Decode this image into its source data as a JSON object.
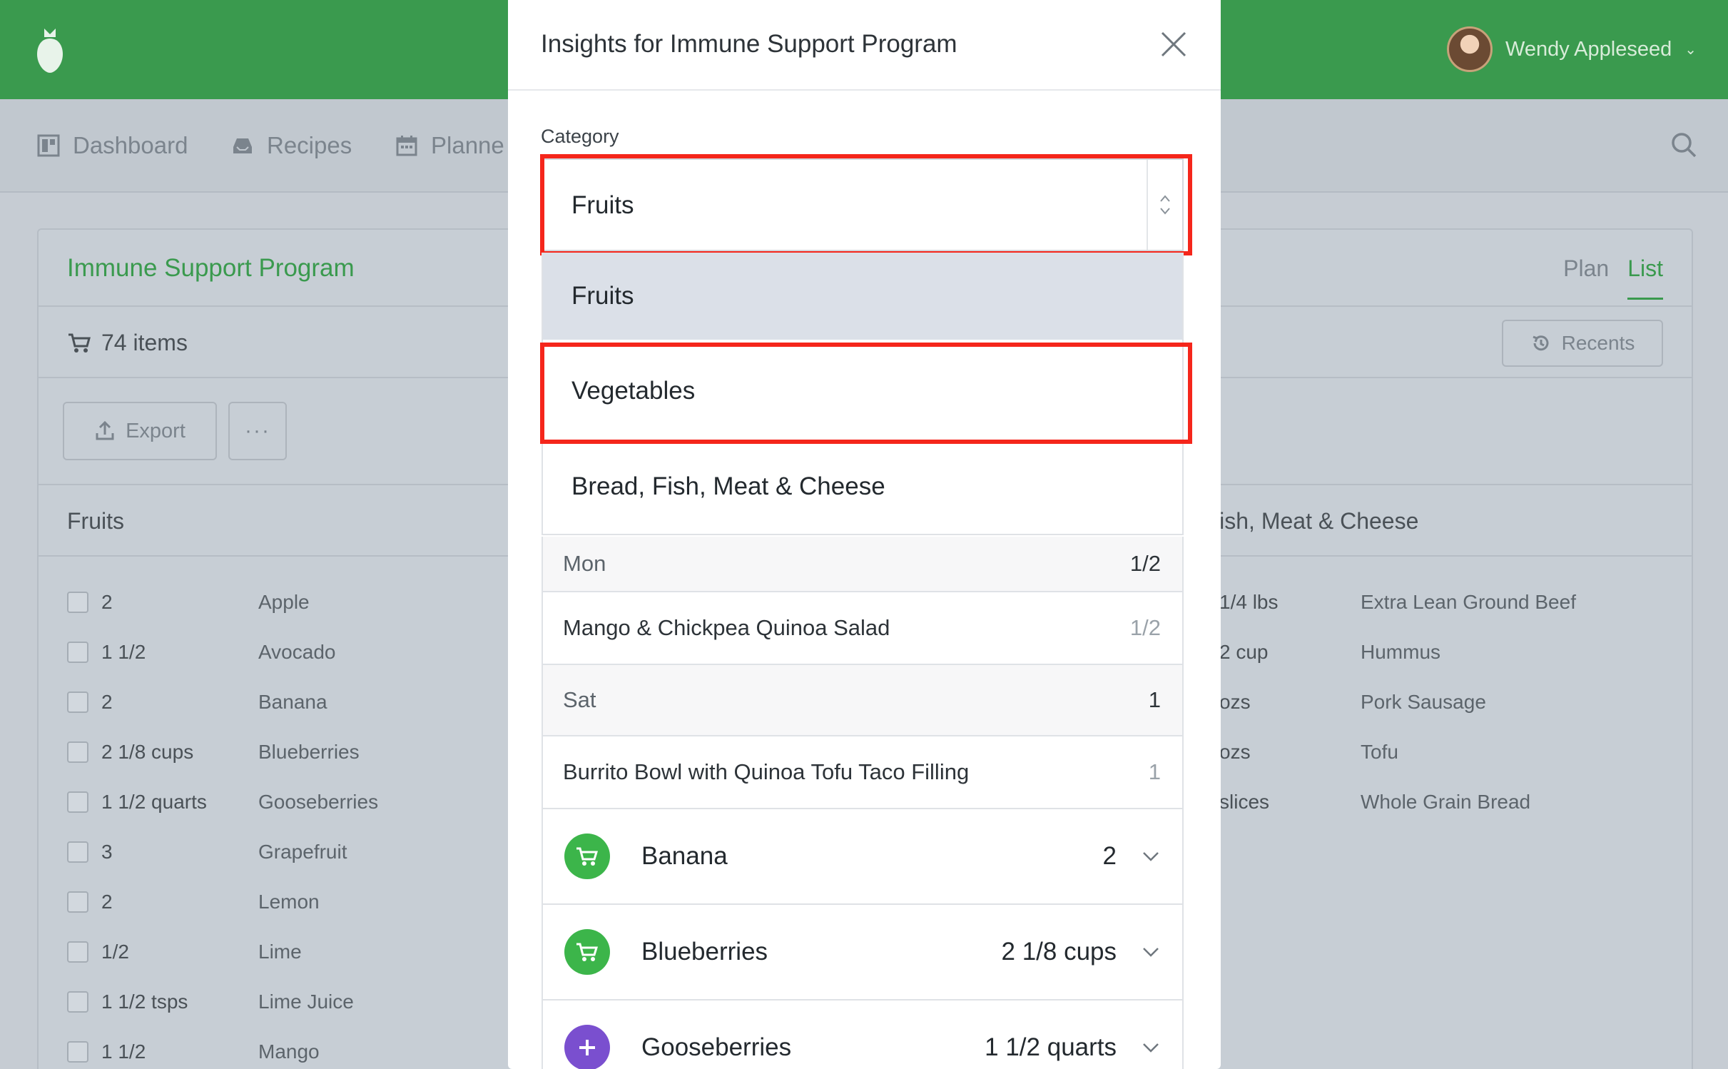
{
  "colors": {
    "brand_green": "#3a9a4e",
    "highlight_red": "#f5261b",
    "cart_green": "#3cb54a",
    "add_purple": "#7a4fcf"
  },
  "header": {
    "user_name": "Wendy Appleseed"
  },
  "nav": {
    "dashboard": "Dashboard",
    "recipes": "Recipes",
    "planner": "Planne"
  },
  "program": {
    "title": "Immune Support Program",
    "tab_plan": "Plan",
    "tab_list": "List",
    "items_count": "74 items",
    "recents": "Recents",
    "export": "Export",
    "more": "···",
    "section_left": "Fruits",
    "section_right": "d, Fish, Meat & Cheese"
  },
  "fruits_list": [
    {
      "qty": "2",
      "name": "Apple"
    },
    {
      "qty": "1 1/2",
      "name": "Avocado"
    },
    {
      "qty": "2",
      "name": "Banana"
    },
    {
      "qty": "2 1/8 cups",
      "name": "Blueberries"
    },
    {
      "qty": "1 1/2 quarts",
      "name": "Gooseberries"
    },
    {
      "qty": "3",
      "name": "Grapefruit"
    },
    {
      "qty": "2",
      "name": "Lemon"
    },
    {
      "qty": "1/2",
      "name": "Lime"
    },
    {
      "qty": "1 1/2 tsps",
      "name": "Lime Juice"
    },
    {
      "qty": "1 1/2",
      "name": "Mango"
    }
  ],
  "meat_list": [
    {
      "qty": "1/4 lbs",
      "name": "Extra Lean Ground Beef"
    },
    {
      "qty": "2 cup",
      "name": "Hummus"
    },
    {
      "qty": "ozs",
      "name": "Pork Sausage"
    },
    {
      "qty": "ozs",
      "name": "Tofu"
    },
    {
      "qty": "slices",
      "name": "Whole Grain Bread"
    }
  ],
  "modal": {
    "title": "Insights for Immune Support Program",
    "category_label": "Category",
    "selected_value": "Fruits",
    "options": [
      "Fruits",
      "Vegetables",
      "Bread, Fish, Meat & Cheese"
    ],
    "detail_rows": [
      {
        "left": "Mon",
        "right": "1/2",
        "kind": "day"
      },
      {
        "left": "Mango & Chickpea Quinoa Salad",
        "right": "1/2",
        "kind": "meal"
      },
      {
        "left": "Sat",
        "right": "1",
        "kind": "day"
      },
      {
        "left": "Burrito Bowl with Quinoa Tofu Taco Filling",
        "right": "1",
        "kind": "meal"
      }
    ],
    "ingredients": [
      {
        "name": "Banana",
        "qty": "2",
        "icon": "cart-icon"
      },
      {
        "name": "Blueberries",
        "qty": "2 1/8 cups",
        "icon": "cart-icon"
      },
      {
        "name": "Gooseberries",
        "qty": "1 1/2 quarts",
        "icon": "plus-icon"
      }
    ]
  }
}
